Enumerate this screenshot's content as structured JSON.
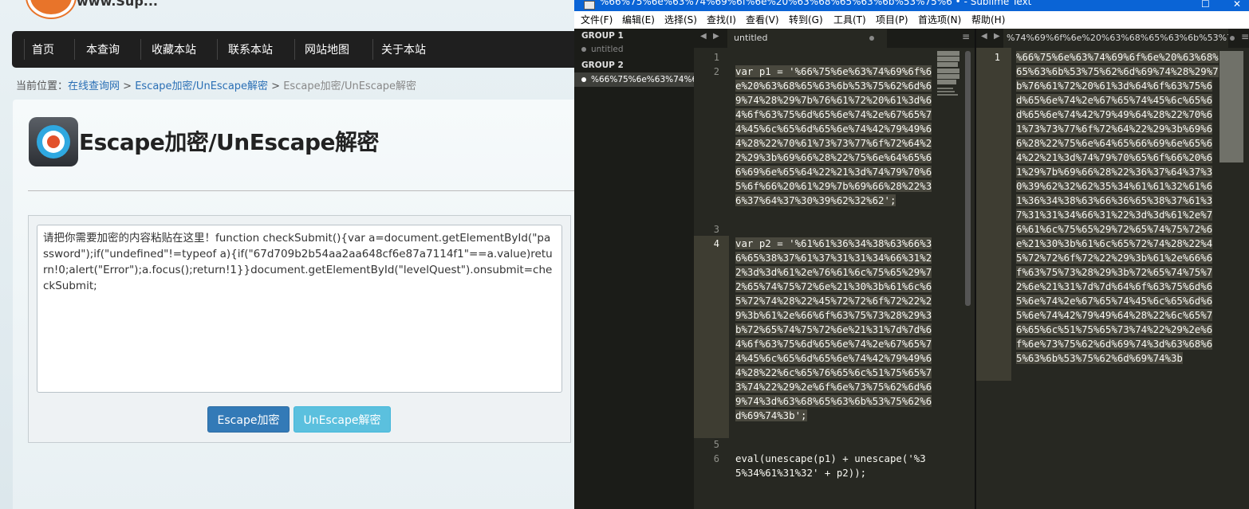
{
  "site": {
    "logo_text": "www.Sup..."
  },
  "nav": {
    "items": [
      "首页",
      "本查询",
      "收藏本站",
      "联系本站",
      "网站地图",
      "关于本站"
    ]
  },
  "breadcrumb": {
    "prefix": "当前位置：",
    "home": "在线查询网",
    "sep1": " > ",
    "section": "Escape加密/UnEscape解密",
    "sep2": " > ",
    "current": "Escape加密/UnEscape解密"
  },
  "page": {
    "title": "Escape加密/UnEscape解密",
    "input_value": "请把你需要加密的内容粘贴在这里！function checkSubmit(){var a=document.getElementById(\"password\");if(\"undefined\"!=typeof a){if(\"67d709b2b54aa2aa648cf6e87a7114f1\"==a.value)return!0;alert(\"Error\");a.focus();return!1}}document.getElementById(\"levelQuest\").onsubmit=checkSubmit;",
    "escape_label": "Escape加密",
    "unescape_label": "UnEscape解密"
  },
  "sublime": {
    "title": "%66%75%6e%63%74%69%6f%6e%20%63%68%65%63%6b%53%75%6 • - Sublime Text",
    "menu": [
      "文件(F)",
      "编辑(E)",
      "选择(S)",
      "查找(I)",
      "查看(V)",
      "转到(G)",
      "工具(T)",
      "项目(P)",
      "首选项(N)",
      "帮助(H)"
    ],
    "sidebar": {
      "group1": "GROUP 1",
      "group1_file": "untitled",
      "group2": "GROUP 2",
      "group2_file": "%66%75%6e%63%74%69"
    },
    "tab1": "untitled",
    "tab2": "%74%69%6f%6e%20%63%68%65%63%6b%53%75%6",
    "pane1": {
      "line_numbers": [
        "1",
        "2",
        "3",
        "4",
        "5",
        "6"
      ],
      "line2": "var p1 = '%66%75%6e%63%74%69%6f%6e%20%63%68%65%63%6b%53%75%62%6d%69%74%28%29%7b%76%61%72%20%61%3d%64%6f%63%75%6d%65%6e%74%2e%67%65%74%45%6c%65%6d%65%6e%74%42%79%49%64%28%22%70%61%73%73%77%6f%72%64%22%29%3b%69%66%28%22%75%6e%64%65%66%69%6e%65%64%22%21%3d%74%79%70%65%6f%66%20%61%29%7b%69%66%28%22%36%37%64%37%30%39%62%32%62';",
      "line4": "var p2 = '%61%61%36%34%38%63%66%36%65%38%37%61%37%31%31%34%66%31%22%3d%3d%61%2e%76%61%6c%75%65%29%72%65%74%75%72%6e%21%30%3b%61%6c%65%72%74%28%22%45%72%72%6f%72%22%29%3b%61%2e%66%6f%63%75%73%28%29%3b%72%65%74%75%72%6e%21%31%7d%7d%64%6f%63%75%6d%65%6e%74%2e%67%65%74%45%6c%65%6d%65%6e%74%42%79%49%64%28%22%6c%65%76%65%6c%51%75%65%73%74%22%29%2e%6f%6e%73%75%62%6d%69%74%3d%63%68%65%63%6b%53%75%62%6d%69%74%3b';",
      "line6": "eval(unescape(p1) + unescape('%35%34%61%31%32' + p2));"
    },
    "pane2": {
      "line_number": "1",
      "line1": "%66%75%6e%63%74%69%6f%6e%20%63%68%65%63%6b%53%75%62%6d%69%74%28%29%7b%76%61%72%20%61%3d%64%6f%63%75%6d%65%6e%74%2e%67%65%74%45%6c%65%6d%65%6e%74%42%79%49%64%28%22%70%61%73%73%77%6f%72%64%22%29%3b%69%66%28%22%75%6e%64%65%66%69%6e%65%64%22%21%3d%74%79%70%65%6f%66%20%61%29%7b%69%66%28%22%36%37%64%37%30%39%62%32%62%35%34%61%61%32%61%61%36%34%38%63%66%36%65%38%37%61%37%31%31%34%66%31%22%3d%3d%61%2e%76%61%6c%75%65%29%72%65%74%75%72%6e%21%30%3b%61%6c%65%72%74%28%22%45%72%72%6f%72%22%29%3b%61%2e%66%6f%63%75%73%28%29%3b%72%65%74%75%72%6e%21%31%7d%7d%64%6f%63%75%6d%65%6e%74%2e%67%65%74%45%6c%65%6d%65%6e%74%42%79%49%64%28%22%6c%65%76%65%6c%51%75%65%73%74%22%29%2e%6f%6e%73%75%62%6d%69%74%3d%63%68%65%63%6b%53%75%62%6d%69%74%3b"
    }
  }
}
